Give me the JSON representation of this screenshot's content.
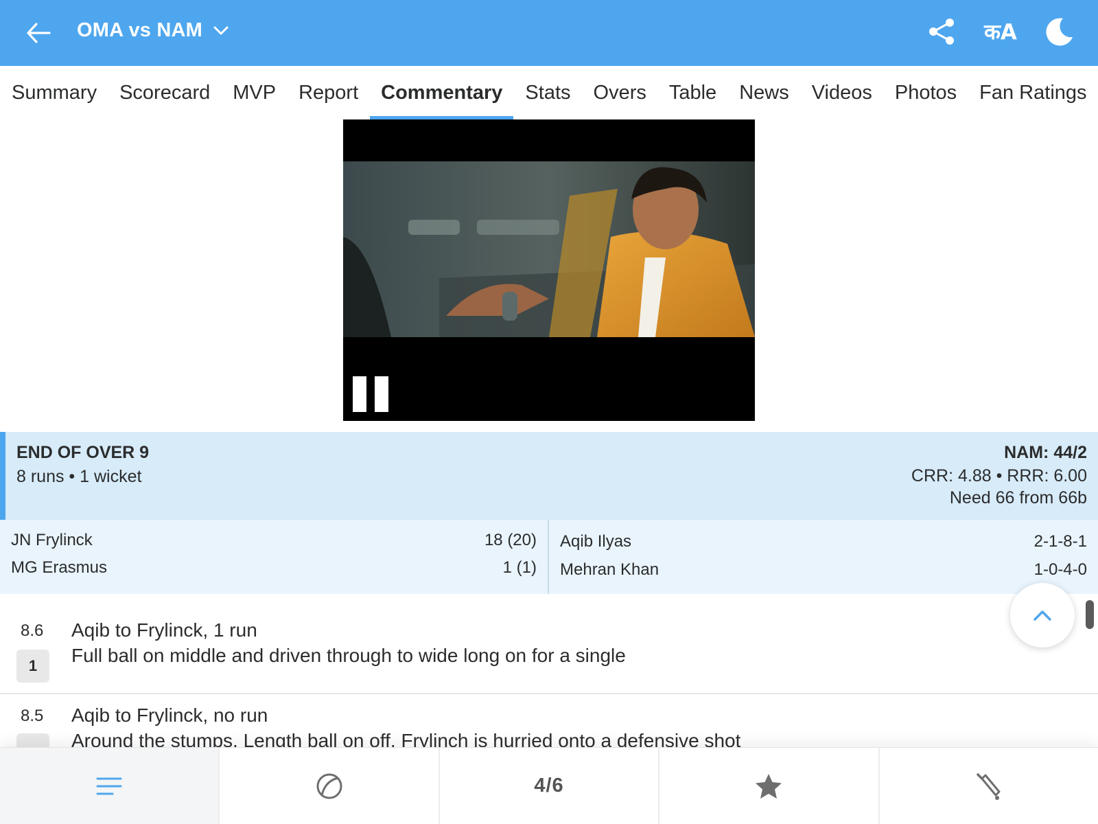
{
  "header": {
    "title": "OMA vs NAM",
    "back_icon": "arrow-left-icon",
    "dropdown_icon": "chevron-down-icon",
    "share_icon": "share-icon",
    "language_label": "कA",
    "theme_icon": "moon-icon",
    "color": "#4ea6ee"
  },
  "tabs": [
    {
      "label": "Summary"
    },
    {
      "label": "Scorecard"
    },
    {
      "label": "MVP"
    },
    {
      "label": "Report"
    },
    {
      "label": "Commentary",
      "active": true
    },
    {
      "label": "Stats"
    },
    {
      "label": "Overs"
    },
    {
      "label": "Table"
    },
    {
      "label": "News"
    },
    {
      "label": "Videos"
    },
    {
      "label": "Photos"
    },
    {
      "label": "Fan Ratings"
    }
  ],
  "video": {
    "state": "playing",
    "control_icon": "pause-icon"
  },
  "over_summary": {
    "title": "END OF OVER 9",
    "subtitle": "8 runs • 1 wicket",
    "score": "NAM: 44/2",
    "rates": "CRR: 4.88 • RRR: 6.00",
    "need": "Need 66 from 66b"
  },
  "batters": [
    {
      "name": "JN Frylinck",
      "score": "18 (20)"
    },
    {
      "name": "MG Erasmus",
      "score": "1 (1)"
    }
  ],
  "bowlers": [
    {
      "name": "Aqib Ilyas",
      "figures": "2-1-8-1"
    },
    {
      "name": "Mehran Khan",
      "figures": "1-0-4-0"
    }
  ],
  "commentary": [
    {
      "over": "8.6",
      "result": "1",
      "headline": "Aqib to Frylinck, 1 run",
      "text": "Full ball on middle and driven through to wide long on for a single"
    },
    {
      "over": "8.5",
      "result": "•",
      "headline": "Aqib to Frylinck, no run",
      "text": "Around the stumps. Length ball on off. Frylinch is hurried onto a defensive shot"
    }
  ],
  "bottom_nav": {
    "items": [
      {
        "icon": "menu-lines-icon",
        "active": true
      },
      {
        "icon": "cricket-ball-icon"
      },
      {
        "label": "4/6"
      },
      {
        "icon": "star-icon"
      },
      {
        "icon": "cricket-bat-icon"
      }
    ]
  },
  "fab_icon": "chevron-up-icon"
}
